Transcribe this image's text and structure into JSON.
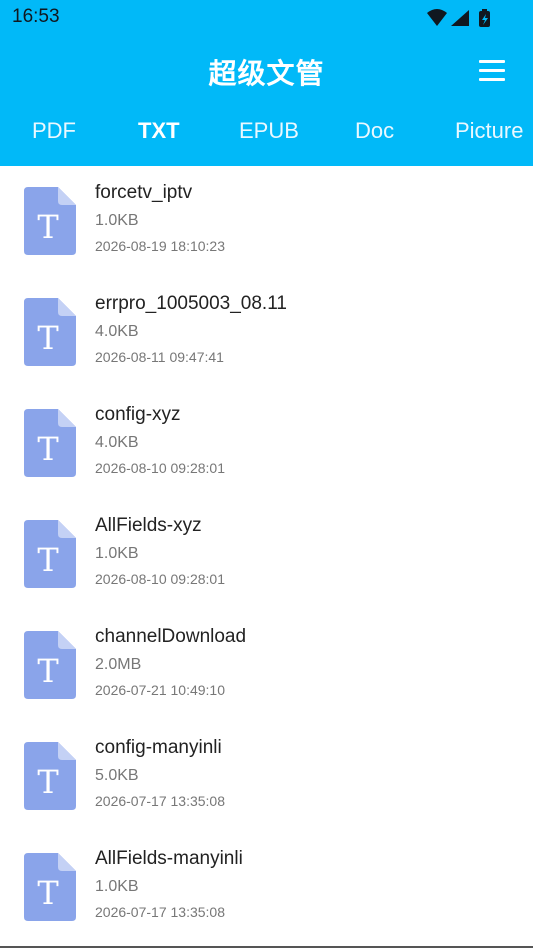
{
  "status": {
    "time": "16:53"
  },
  "app": {
    "title": "超级文管"
  },
  "tabs": [
    {
      "label": "PDF",
      "active": false
    },
    {
      "label": "TXT",
      "active": true
    },
    {
      "label": "EPUB",
      "active": false
    },
    {
      "label": "Doc",
      "active": false
    },
    {
      "label": "Picture",
      "active": false
    }
  ],
  "icon_letter": "T",
  "colors": {
    "header": "#01b9f8",
    "file_icon": "#8aa4ea"
  },
  "files": [
    {
      "name": "forcetv_iptv",
      "size": "1.0KB",
      "date": "2026-08-19 18:10:23"
    },
    {
      "name": "errpro_1005003_08.11",
      "size": "4.0KB",
      "date": "2026-08-11 09:47:41"
    },
    {
      "name": "config-xyz",
      "size": "4.0KB",
      "date": "2026-08-10 09:28:01"
    },
    {
      "name": "AllFields-xyz",
      "size": "1.0KB",
      "date": "2026-08-10 09:28:01"
    },
    {
      "name": "channelDownload",
      "size": "2.0MB",
      "date": "2026-07-21 10:49:10"
    },
    {
      "name": "config-manyinli",
      "size": "5.0KB",
      "date": "2026-07-17 13:35:08"
    },
    {
      "name": "AllFields-manyinli",
      "size": "1.0KB",
      "date": "2026-07-17 13:35:08"
    }
  ]
}
